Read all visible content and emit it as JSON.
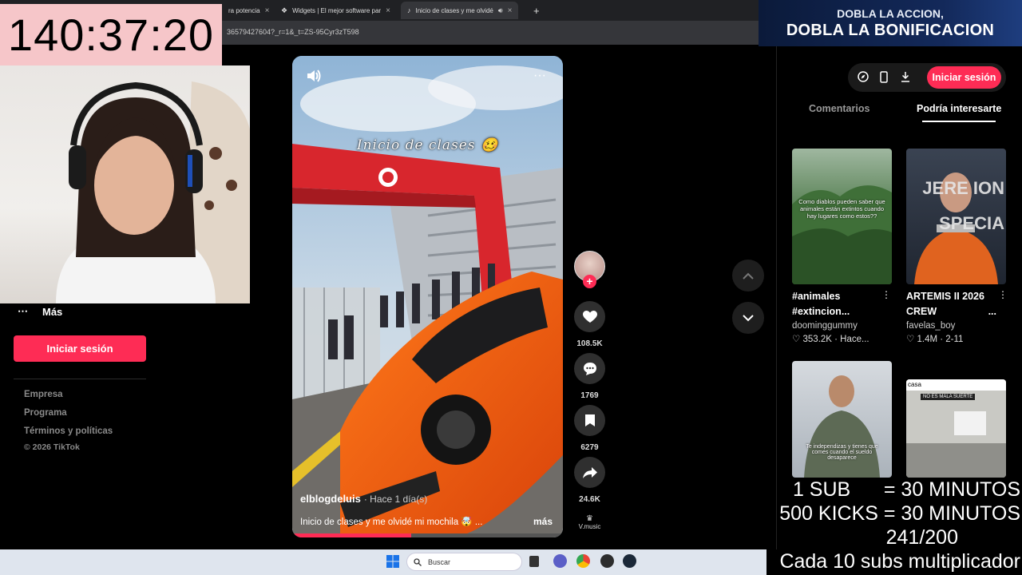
{
  "browser": {
    "tabs": [
      {
        "label": "ra potencia",
        "close": "×"
      },
      {
        "label": "Widgets | El mejor software par",
        "close": "×"
      },
      {
        "label": "Inicio de clases y me olvidé",
        "close": "×"
      }
    ],
    "new_tab": "+",
    "url": "36579427604?_r=1&_t=ZS-95Cyr3zT598"
  },
  "stream": {
    "timer": "140:37:20",
    "promo_line1": "DOBLA LA ACCION,",
    "promo_line2": "DOBLA LA BONIFICACION",
    "stats": [
      "1 SUB      = 30 MINUTOS",
      "500 KICKS = 30 MINUTOS",
      "241/200",
      "Cada 10 subs multiplicador"
    ]
  },
  "sidebar": {
    "more_icon": "⋯",
    "more_label": "Más",
    "login": "Iniciar sesión",
    "links": [
      "Empresa",
      "Programa",
      "Términos y políticas"
    ],
    "copyright": "© 2026 TikTok"
  },
  "video": {
    "overlay_text": "Inicio de clases 🥴",
    "author": "elblogdeluis",
    "time": "· Hace 1 día(s)",
    "caption": "Inicio de clases y me olvidé mi mochila 🤯 ...",
    "more": "más",
    "progress": 0.44,
    "menu": "···"
  },
  "actions": {
    "likes": "108.5K",
    "comments": "1769",
    "saves": "6279",
    "shares": "24.6K",
    "music": "V.music",
    "follow": "+"
  },
  "right_panel": {
    "login": "Iniciar sesión",
    "tab_comments": "Comentarios",
    "tab_suggest": "Podría interesarte",
    "cards": [
      {
        "thumb_text": "Como diablos pueden saber que animales están extintos cuando hay lugares como estos??",
        "title_line1": "#animales",
        "title_line2": "#extincion...",
        "user": "doominggummy",
        "stats": "♡ 353.2K · Hace...",
        "menu": "⋮"
      },
      {
        "thumb_text": "JERE ION SPECIA",
        "title_line1": "ARTEMIS II 2026",
        "title_line2": "CREW",
        "title_more": "...",
        "user": "favelas_boy",
        "stats": "♡ 1.4M · 2-11",
        "menu": "⋮"
      },
      {
        "thumb_text": "Te independizas y tienes que comes cuando el sueldo desaparece"
      },
      {
        "thumb_label": "casa",
        "thumb_text": "NO ES MALA SUERTE"
      }
    ]
  },
  "taskbar": {
    "search": "Buscar"
  }
}
